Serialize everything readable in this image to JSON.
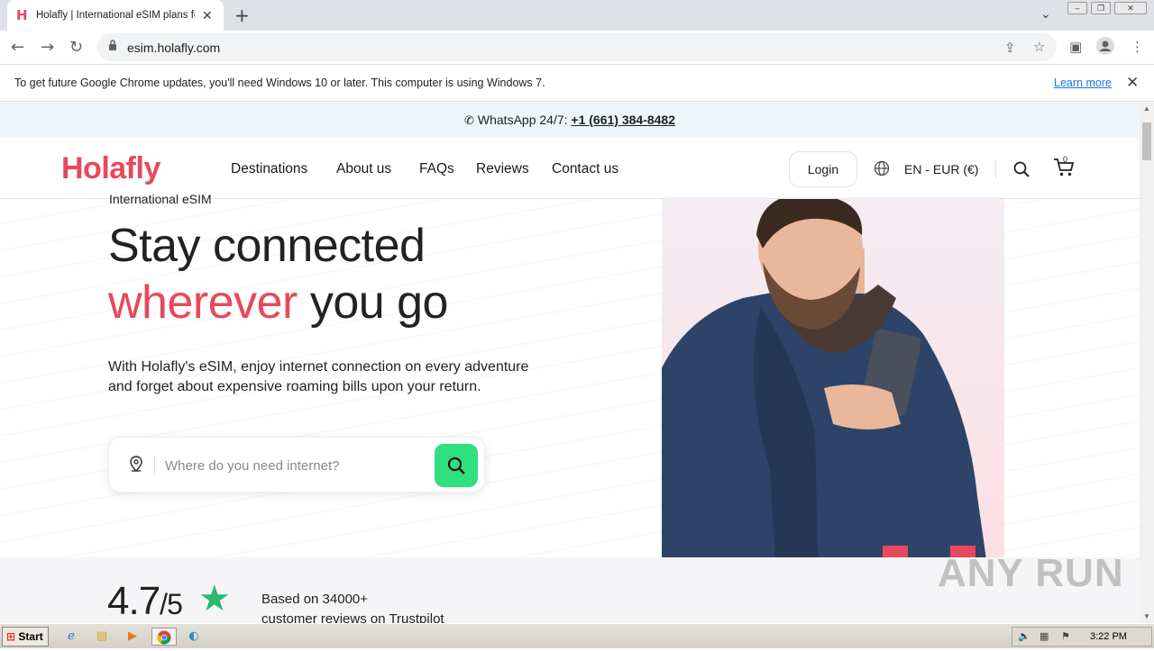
{
  "browser": {
    "tab_title": "Holafly | International eSIM plans fo",
    "tab_favicon": "H",
    "new_tab": "+",
    "url": "esim.holafly.com",
    "infobar_message": "To get future Google Chrome updates, you'll need Windows 10 or later. This computer is using Windows 7.",
    "infobar_link": "Learn more"
  },
  "topbar": {
    "whatsapp_label": "WhatsApp 24/7:",
    "phone": "+1 (661) 384-8482"
  },
  "nav": {
    "logo": "Holafly",
    "links": [
      "Destinations",
      "About us",
      "FAQs",
      "Reviews",
      "Contact us"
    ],
    "login": "Login",
    "language": "EN - EUR (€)",
    "cart_count": "0"
  },
  "hero": {
    "eyebrow": "International eSIM",
    "headline_line1": "Stay connected",
    "headline_accent": "wherever",
    "headline_rest": "you go",
    "lede": "With Holafly's eSIM, enjoy internet connection on every adventure and forget about expensive roaming bills upon your return.",
    "search_placeholder": "Where do you need internet?"
  },
  "rating": {
    "score": "4.7",
    "out_of": "/5",
    "line1": "Based on 34000+",
    "line2": "customer reviews on Trustpilot"
  },
  "watermark": "ANY RUN",
  "taskbar": {
    "start": "Start",
    "clock": "3:22 PM"
  },
  "colors": {
    "brand": "#e8485c",
    "search_button": "#2ee07e",
    "trustpilot_star": "#2fb774"
  }
}
